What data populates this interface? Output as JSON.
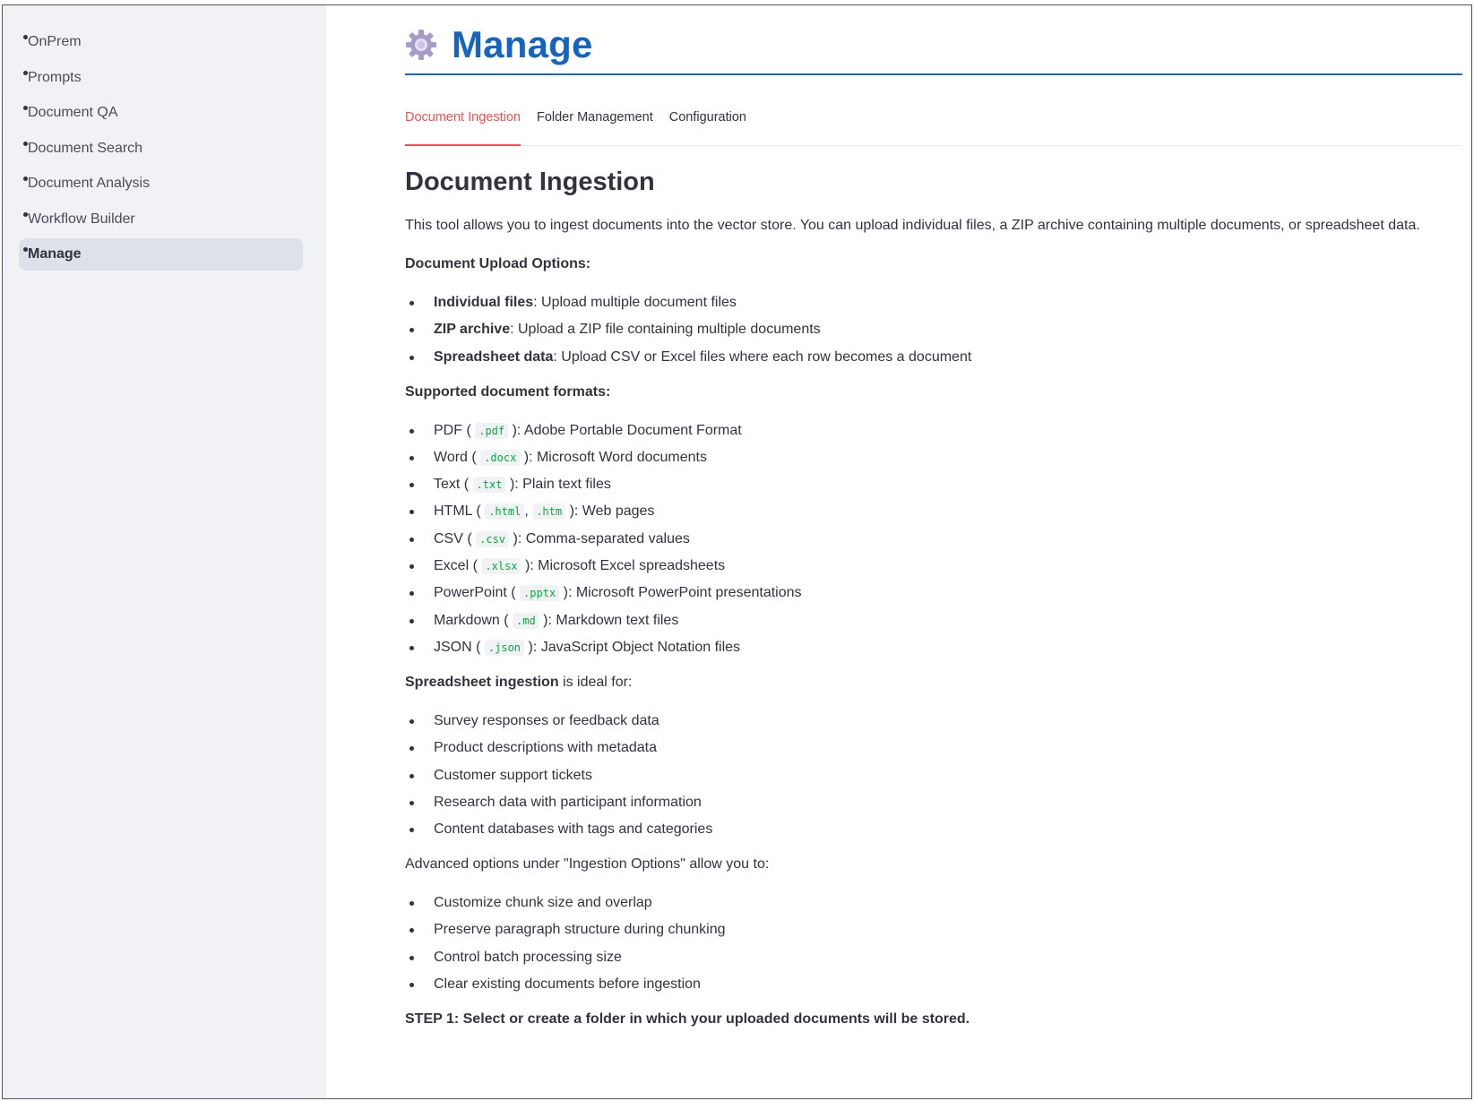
{
  "sidebar": {
    "items": [
      {
        "label": "OnPrem"
      },
      {
        "label": "Prompts"
      },
      {
        "label": "Document QA"
      },
      {
        "label": "Document Search"
      },
      {
        "label": "Document Analysis"
      },
      {
        "label": "Workflow Builder"
      },
      {
        "label": "Manage",
        "active": true
      }
    ]
  },
  "page": {
    "title": "Manage",
    "title_color": "#1565c0",
    "icon": "gear-icon"
  },
  "tabs": [
    {
      "label": "Document Ingestion",
      "active": true
    },
    {
      "label": "Folder Management"
    },
    {
      "label": "Configuration"
    }
  ],
  "content": {
    "heading": "Document Ingestion",
    "intro": "This tool allows you to ingest documents into the vector store. You can upload individual files, a ZIP archive containing multiple documents, or spreadsheet data.",
    "upload_heading": "Document Upload Options:",
    "upload_options": [
      {
        "bold": "Individual files",
        "text": ": Upload multiple document files"
      },
      {
        "bold": "ZIP archive",
        "text": ": Upload a ZIP file containing multiple documents"
      },
      {
        "bold": "Spreadsheet data",
        "text": ": Upload CSV or Excel files where each row becomes a document"
      }
    ],
    "formats_heading": "Supported document formats:",
    "formats": [
      {
        "name": "PDF (",
        "exts": [
          ".pdf"
        ],
        "desc": "): Adobe Portable Document Format"
      },
      {
        "name": "Word (",
        "exts": [
          ".docx"
        ],
        "desc": "): Microsoft Word documents"
      },
      {
        "name": "Text (",
        "exts": [
          ".txt"
        ],
        "desc": "): Plain text files"
      },
      {
        "name": "HTML (",
        "exts": [
          ".html",
          ".htm"
        ],
        "desc": "): Web pages"
      },
      {
        "name": "CSV (",
        "exts": [
          ".csv"
        ],
        "desc": "): Comma-separated values"
      },
      {
        "name": "Excel (",
        "exts": [
          ".xlsx"
        ],
        "desc": "): Microsoft Excel spreadsheets"
      },
      {
        "name": "PowerPoint (",
        "exts": [
          ".pptx"
        ],
        "desc": "): Microsoft PowerPoint presentations"
      },
      {
        "name": "Markdown (",
        "exts": [
          ".md"
        ],
        "desc": "): Markdown text files"
      },
      {
        "name": "JSON (",
        "exts": [
          ".json"
        ],
        "desc": "): JavaScript Object Notation files"
      }
    ],
    "spreadsheet_bold": "Spreadsheet ingestion",
    "spreadsheet_rest": " is ideal for:",
    "spreadsheet_uses": [
      "Survey responses or feedback data",
      "Product descriptions with metadata",
      "Customer support tickets",
      "Research data with participant information",
      "Content databases with tags and categories"
    ],
    "advanced_intro": "Advanced options under \"Ingestion Options\" allow you to:",
    "advanced_options": [
      "Customize chunk size and overlap",
      "Preserve paragraph structure during chunking",
      "Control batch processing size",
      "Clear existing documents before ingestion"
    ],
    "step1": "STEP 1: Select or create a folder in which your uploaded documents will be stored."
  }
}
